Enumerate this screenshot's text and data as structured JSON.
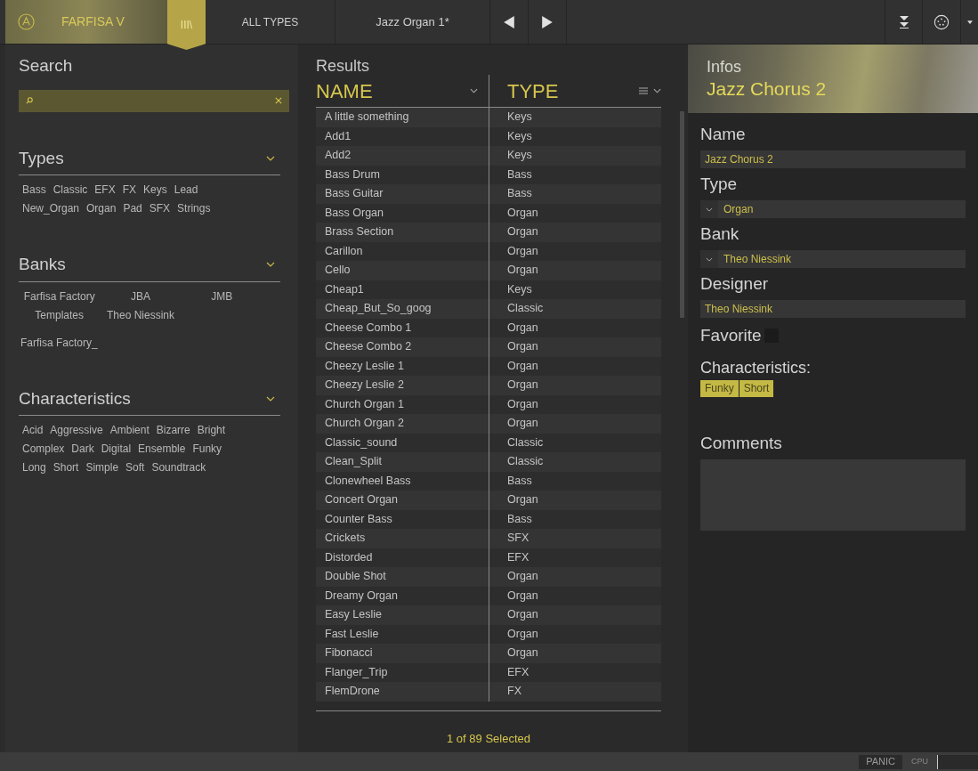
{
  "topbar": {
    "product": "FARFISA V",
    "library_label": "III\\",
    "library_selected": true,
    "filter": "ALL TYPES",
    "preset": "Jazz Organ 1*"
  },
  "search": {
    "title": "Search"
  },
  "types": {
    "title": "Types",
    "expanded": true,
    "items": [
      "Bass",
      "Classic",
      "EFX",
      "FX",
      "Keys",
      "Lead",
      "New_Organ",
      "Organ",
      "Pad",
      "SFX",
      "Strings"
    ]
  },
  "banks": {
    "title": "Banks",
    "expanded": true,
    "groups": [
      {
        "items": [
          "Farfisa Factory",
          "JBA",
          "JMB",
          "Templates",
          "Theo Niessink"
        ]
      },
      {
        "items": [
          "Farfisa Factory_"
        ]
      }
    ]
  },
  "characteristics": {
    "title": "Characteristics",
    "expanded": true,
    "items": [
      "Acid",
      "Aggressive",
      "Ambient",
      "Bizarre",
      "Bright",
      "Complex",
      "Dark",
      "Digital",
      "Ensemble",
      "Funky",
      "Long",
      "Short",
      "Simple",
      "Soft",
      "Soundtrack"
    ]
  },
  "results": {
    "title": "Results",
    "columns": [
      "NAME",
      "TYPE"
    ],
    "rows": [
      [
        "A little something",
        "Keys"
      ],
      [
        "Add1",
        "Keys"
      ],
      [
        "Add2",
        "Keys"
      ],
      [
        "Bass Drum",
        "Bass"
      ],
      [
        "Bass Guitar",
        "Bass"
      ],
      [
        "Bass Organ",
        "Organ"
      ],
      [
        "Brass Section",
        "Organ"
      ],
      [
        "Carillon",
        "Organ"
      ],
      [
        "Cello",
        "Organ"
      ],
      [
        "Cheap1",
        "Keys"
      ],
      [
        "Cheap_But_So_goog",
        "Classic"
      ],
      [
        "Cheese Combo 1",
        "Organ"
      ],
      [
        "Cheese Combo 2",
        "Organ"
      ],
      [
        "Cheezy Leslie 1",
        "Organ"
      ],
      [
        "Cheezy Leslie 2",
        "Organ"
      ],
      [
        "Church Organ 1",
        "Organ"
      ],
      [
        "Church Organ 2",
        "Organ"
      ],
      [
        "Classic_sound",
        "Classic"
      ],
      [
        "Clean_Split",
        "Classic"
      ],
      [
        "Clonewheel Bass",
        "Bass"
      ],
      [
        "Concert Organ",
        "Organ"
      ],
      [
        "Counter Bass",
        "Bass"
      ],
      [
        "Crickets",
        "SFX"
      ],
      [
        "Distorded",
        "EFX"
      ],
      [
        "Double Shot",
        "Organ"
      ],
      [
        "Dreamy Organ",
        "Organ"
      ],
      [
        "Easy Leslie",
        "Organ"
      ],
      [
        "Fast Leslie",
        "Organ"
      ],
      [
        "Fibonacci",
        "Organ"
      ],
      [
        "Flanger_Trip",
        "EFX"
      ],
      [
        "FlemDrone",
        "FX"
      ]
    ],
    "footer": "1 of 89 Selected"
  },
  "infos": {
    "title": "Infos",
    "preset": "Jazz Chorus 2",
    "fields": [
      {
        "kind": "text",
        "label": "Name",
        "value": "Jazz Chorus 2"
      },
      {
        "kind": "dropdown",
        "label": "Type",
        "value": "Organ"
      },
      {
        "kind": "dropdown",
        "label": "Bank",
        "value": "Theo Niessink"
      },
      {
        "kind": "text",
        "label": "Designer",
        "value": "Theo Niessink"
      }
    ],
    "favorite": {
      "label": "Favorite",
      "checked": false
    },
    "characteristics_label": "Characteristics:",
    "tags": [
      "Funky",
      "Short"
    ],
    "comments_label": "Comments"
  },
  "status_bar": {
    "panic": "PANIC",
    "cpu": "CPU"
  }
}
